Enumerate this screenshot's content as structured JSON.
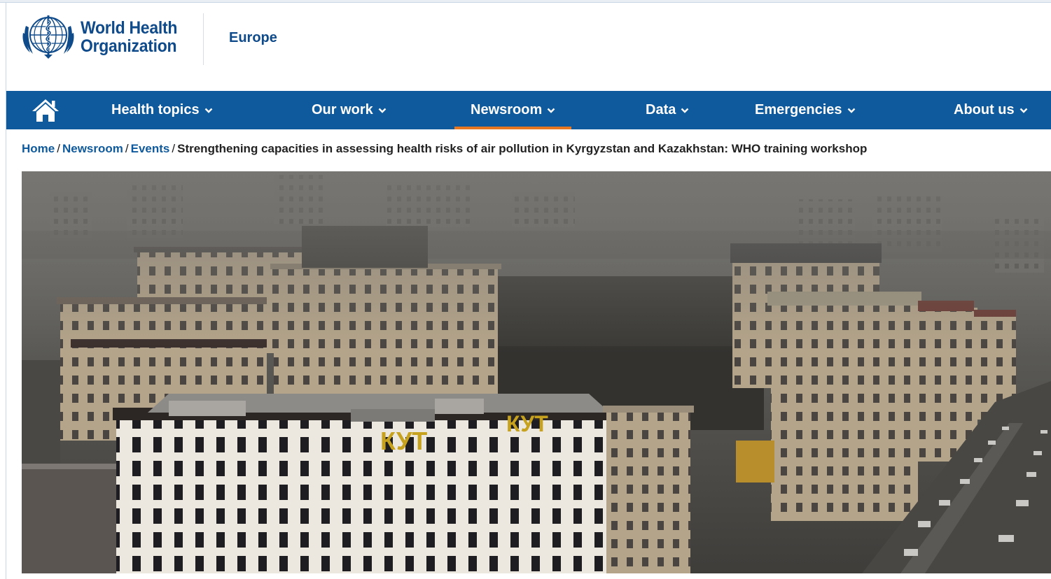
{
  "header": {
    "logo_line1": "World Health",
    "logo_line2": "Organization",
    "logo_icon": "who-emblem-icon",
    "region": "Europe"
  },
  "nav": {
    "home_icon": "home-icon",
    "items": [
      {
        "label": "Health topics",
        "active": false
      },
      {
        "label": "Our work",
        "active": false
      },
      {
        "label": "Newsroom",
        "active": true
      },
      {
        "label": "Data",
        "active": false
      },
      {
        "label": "Emergencies",
        "active": false
      },
      {
        "label": "About us",
        "active": false
      }
    ]
  },
  "breadcrumb": {
    "home": "Home",
    "newsroom": "Newsroom",
    "events": "Events",
    "separator": "/",
    "current": "Strengthening capacities in assessing health risks of air pollution in Kyrgyzstan and Kazakhstan: WHO training workshop"
  },
  "hero": {
    "sign_text_left": "КУТ",
    "sign_text_right": "КУТ"
  },
  "colors": {
    "brand_blue": "#0f5a9c",
    "logo_blue": "#0f4a8a",
    "active_underline": "#e87722"
  }
}
